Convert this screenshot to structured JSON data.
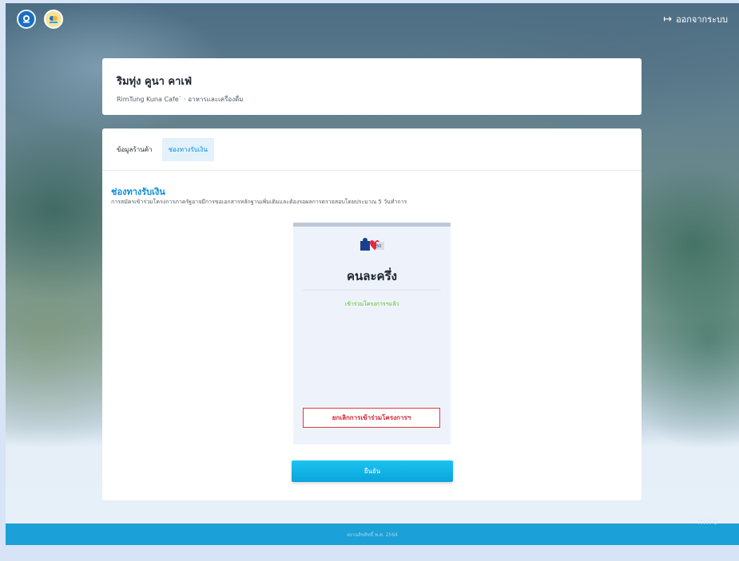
{
  "topbar": {
    "logout_label": "ออกจากระบบ",
    "logout_icon": "sign-out-icon"
  },
  "shop": {
    "name": "ริมทุ่ง คูนา คาเฟ่",
    "subtitle": "RimTung Kuna Cafe` · อาหารและเครื่องดื่ม"
  },
  "tabs": [
    {
      "label": "ข้อมูลร้านค้า",
      "active": false
    },
    {
      "label": "ช่องทางรับเงิน",
      "active": true
    }
  ],
  "section": {
    "title": "ช่องทางรับเงิน",
    "description": "การสมัครเข้าร่วมโครงการภาครัฐอาจมีการขอเอกสารหลักฐานเพิ่มเติมและต้องรอผลการตรวจสอบโดยประมาณ 5 วันทำการ"
  },
  "program": {
    "name": "คนละครึ่ง",
    "status": "เข้าร่วมโครงการฯแล้ว",
    "cancel_label": "ยกเลิกการเข้าร่วมโครงการฯ",
    "status_color": "#52c41a",
    "cancel_color": "#d21f2e"
  },
  "confirm_label": "ยืนยัน",
  "footer": {
    "text": "สงวนลิขสิทธิ์ พ.ศ. 2564"
  },
  "watermark": "miro",
  "colors": {
    "accent": "#0d8ed9",
    "footer": "#1ba0d8"
  }
}
